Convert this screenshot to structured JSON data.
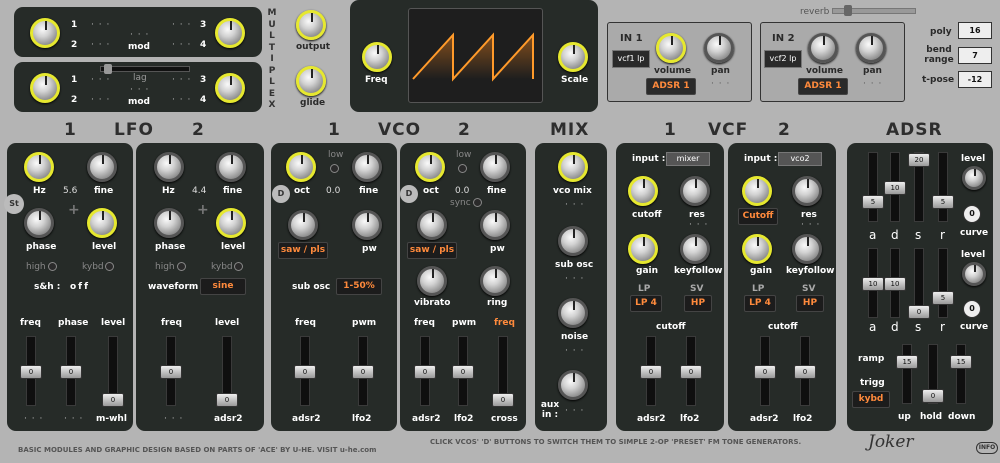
{
  "multiplex": {
    "letters": [
      "M",
      "U",
      "L",
      "T",
      "I",
      "P",
      "L",
      "E",
      "X"
    ],
    "n1": "1",
    "n2": "2",
    "n3": "3",
    "n4": "4",
    "mod": "mod",
    "lag": "lag",
    "dots": "· · ·"
  },
  "glide": {
    "output": "output",
    "glide": "glide"
  },
  "scope": {
    "freq": "Freq",
    "scale": "Scale"
  },
  "reverb": "reverb",
  "in1": {
    "title": "IN 1",
    "src": "vcf1 lp",
    "volume": "volume",
    "pan": "pan",
    "env": "ADSR 1"
  },
  "in2": {
    "title": "IN 2",
    "src": "vcf2 lp",
    "volume": "volume",
    "pan": "pan",
    "env": "ADSR 1"
  },
  "global": {
    "poly": "poly",
    "poly_val": "16",
    "bend": "bend range",
    "bend_val": "7",
    "tpose": "t-pose",
    "tpose_val": "-12"
  },
  "headers": {
    "lfo1": "1",
    "lfo": "LFO",
    "lfo2": "2",
    "vco1": "1",
    "vco": "VCO",
    "vco2": "2",
    "mix": "MIX",
    "vcf1": "1",
    "vcf": "VCF",
    "vcf2": "2",
    "adsr": "ADSR"
  },
  "lfo1": {
    "hz": "Hz",
    "hz_val": "5.6",
    "fine": "fine",
    "phase": "phase",
    "level": "level",
    "high": "high",
    "kybd": "kybd",
    "sh": "s&h :",
    "sh_val": "off",
    "st": "St",
    "s1": "freq",
    "s2": "phase",
    "s3": "level",
    "b1": "· · ·",
    "b2": "· · ·",
    "b3": "m-whl",
    "v1": "0",
    "v2": "0",
    "v3": "0"
  },
  "lfo2": {
    "hz": "Hz",
    "hz_val": "4.4",
    "fine": "fine",
    "phase": "phase",
    "level": "level",
    "high": "high",
    "kybd": "kybd",
    "wave": "waveform",
    "wave_val": "sine",
    "s1": "freq",
    "s2": "level",
    "b1": "· · ·",
    "b2": "adsr2",
    "v1": "0",
    "v2": "0"
  },
  "vco1": {
    "d": "D",
    "oct": "oct",
    "low": "low",
    "oct_val": "0.0",
    "fine": "fine",
    "wave": "saw / pls",
    "pw": "pw",
    "sub": "sub osc",
    "sub_val": "1-50%",
    "s1": "freq",
    "s2": "pwm",
    "b1": "adsr2",
    "b2": "lfo2",
    "v1": "0",
    "v2": "0"
  },
  "vco2": {
    "d": "D",
    "oct": "oct",
    "low": "low",
    "oct_val": "0.0",
    "fine": "fine",
    "sync": "sync",
    "wave": "saw / pls",
    "pw": "pw",
    "vibrato": "vibrato",
    "ring": "ring",
    "s1": "freq",
    "s2": "pwm",
    "s3": "freq",
    "b1": "adsr2",
    "b2": "lfo2",
    "b3": "cross",
    "v1": "0",
    "v2": "0",
    "v3": "0"
  },
  "mix": {
    "vco": "vco mix",
    "sub": "sub osc",
    "noise": "noise",
    "aux": "aux in :",
    "dots": "· · ·"
  },
  "vcf1": {
    "input": "input :",
    "input_val": "mixer",
    "cutoff": "cutoff",
    "res": "res",
    "gain": "gain",
    "kf": "keyfollow",
    "lp": "LP",
    "lp_val": "LP 4",
    "sv": "SV",
    "sv_val": "HP",
    "cut2": "cutoff",
    "b1": "adsr2",
    "b2": "lfo2",
    "v1": "0",
    "v2": "0"
  },
  "vcf2": {
    "input": "input :",
    "input_val": "vco2",
    "cutoff": "Cutoff",
    "res": "res",
    "gain": "gain",
    "kf": "keyfollow",
    "lp": "LP",
    "lp_val": "LP 4",
    "sv": "SV",
    "sv_val": "HP",
    "cut2": "cutoff",
    "b1": "adsr2",
    "b2": "lfo2",
    "v1": "0",
    "v2": "0"
  },
  "adsr": {
    "a": "a",
    "d": "d",
    "s": "s",
    "r": "r",
    "level": "level",
    "curve": "curve",
    "e1": [
      "5",
      "10",
      "20",
      "5"
    ],
    "e2": [
      "10",
      "10",
      "0",
      "5"
    ],
    "lv": "0",
    "cv": "0",
    "ramp": "ramp",
    "trigg": "trigg",
    "trigg_val": "kybd",
    "up": "up",
    "hold": "hold",
    "down": "down",
    "ru": "15",
    "rh": "0",
    "rd": "15"
  },
  "footer": {
    "credit": "BASIC MODULES AND GRAPHIC DESIGN BASED ON PARTS OF 'ACE' BY U-HE.  VISIT u-he.com",
    "hint": "CLICK VCOS' 'D' BUTTONS TO SWITCH THEM TO SIMPLE 2-OP 'PRESET' FM TONE GENERATORS.",
    "logo": "Joker",
    "info": "INFO"
  },
  "colors": {
    "accent": "#ff8a3c",
    "knob_ring": "#e6e82f",
    "panel": "#262b28",
    "bg": "#b4b4b4"
  }
}
